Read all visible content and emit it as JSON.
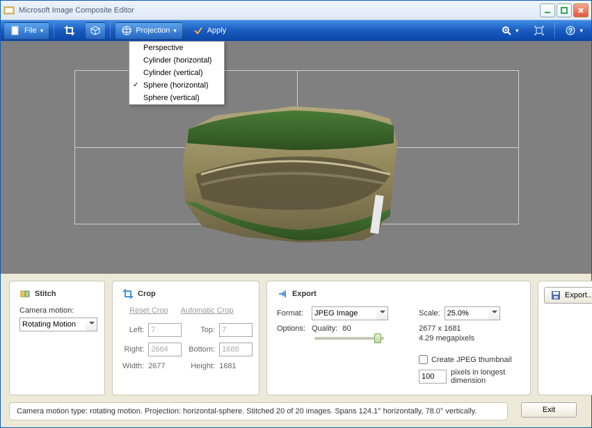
{
  "window": {
    "title": "Microsoft Image Composite Editor"
  },
  "toolbar": {
    "file_label": "File",
    "projection_label": "Projection",
    "apply_label": "Apply"
  },
  "projection_menu": {
    "items": [
      "Perspective",
      "Cylinder (horizontal)",
      "Cylinder (vertical)",
      "Sphere (horizontal)",
      "Sphere (vertical)"
    ],
    "selected_index": 3
  },
  "panels": {
    "stitch": {
      "title": "Stitch",
      "camera_motion_label": "Camera motion:",
      "camera_motion_value": "Rotating Motion"
    },
    "crop": {
      "title": "Crop",
      "reset_link": "Reset Crop",
      "auto_link": "Automatic Crop",
      "left_label": "Left:",
      "left_value": "7",
      "top_label": "Top:",
      "top_value": "7",
      "right_label": "Right:",
      "right_value": "2684",
      "bottom_label": "Bottom:",
      "bottom_value": "1688",
      "width_label": "Width:",
      "width_value": "2677",
      "height_label": "Height:",
      "height_value": "1681"
    },
    "export": {
      "title": "Export",
      "format_label": "Format:",
      "format_value": "JPEG Image",
      "options_label": "Options:",
      "quality_label": "Quality:",
      "quality_value": "80",
      "scale_label": "Scale:",
      "scale_value": "25.0%",
      "dims": "2677 x 1681",
      "megapixels": "4.29 megapixels",
      "thumb_checkbox_label": "Create JPEG thumbnail",
      "thumb_px_value": "100",
      "thumb_px_label": "pixels in longest dimension",
      "export_button": "Export..."
    }
  },
  "statusbar": "Camera motion type: rotating motion. Projection: horizontal-sphere. Stitched 20 of 20 images. Spans 124.1° horizontally, 78.0° vertically.",
  "exit_button": "Exit"
}
